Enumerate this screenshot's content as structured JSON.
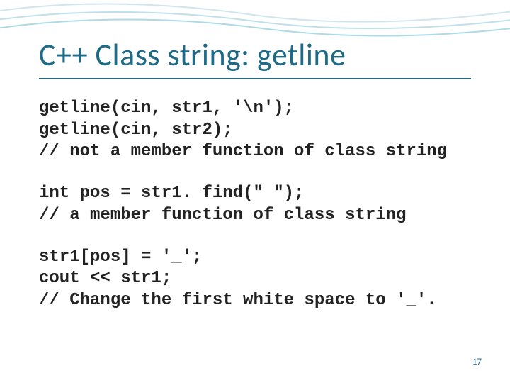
{
  "title": "C++ Class string: getline",
  "code_blocks": [
    "getline(cin, str1, '\\n');\ngetline(cin, str2);\n// not a member function of class string",
    "int pos = str1. find(\" \");\n// a member function of class string",
    "str1[pos] = '_';\ncout << str1;\n// Change the first white space to '_'."
  ],
  "page_number": "17"
}
